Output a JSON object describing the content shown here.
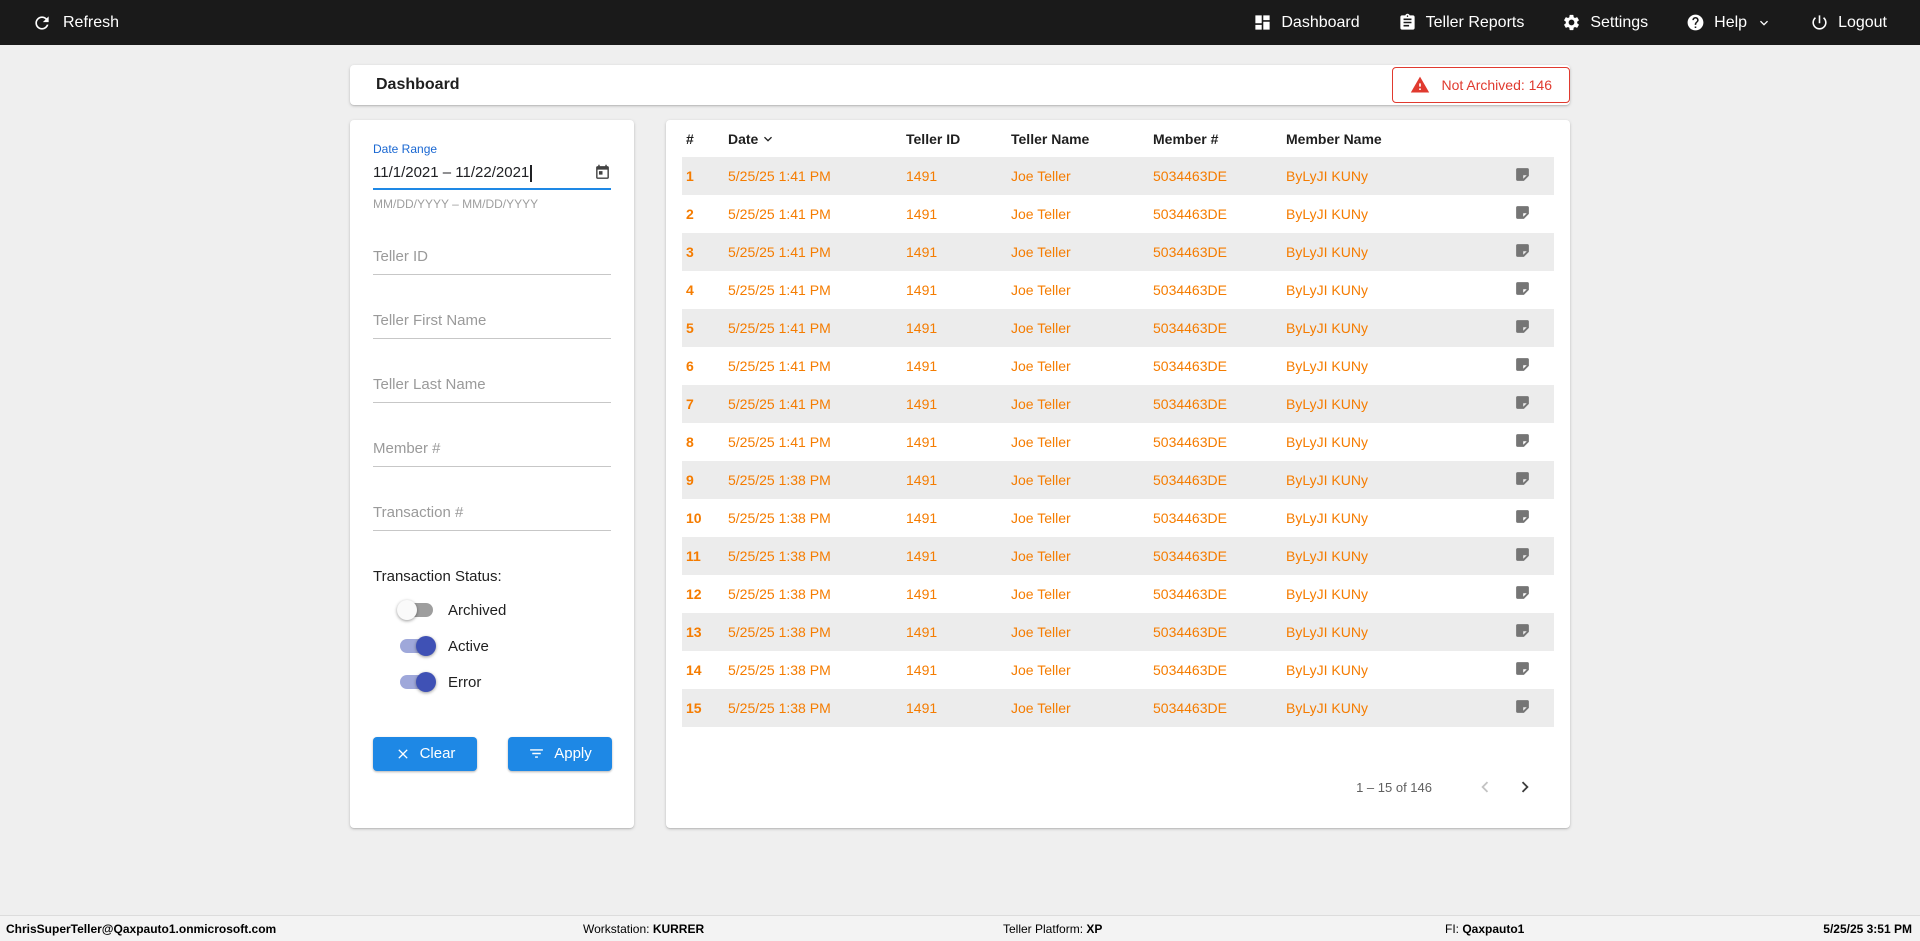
{
  "colors": {
    "accent-orange": "#F57C00",
    "primary-blue": "#1E88E5",
    "alert-red": "#E03A2F",
    "topbar-bg": "#1A1A1A"
  },
  "topbar": {
    "refresh_label": "Refresh",
    "dashboard_label": "Dashboard",
    "teller_reports_label": "Teller Reports",
    "settings_label": "Settings",
    "help_label": "Help",
    "logout_label": "Logout"
  },
  "header": {
    "title": "Dashboard",
    "not_archived_badge": "Not Archived: 146"
  },
  "filters": {
    "date_range_label": "Date Range",
    "date_range_value": "11/1/2021 – 11/22/2021",
    "date_range_hint": "MM/DD/YYYY – MM/DD/YYYY",
    "teller_id_placeholder": "Teller ID",
    "teller_first_name_placeholder": "Teller First Name",
    "teller_last_name_placeholder": "Teller Last Name",
    "member_number_placeholder": "Member #",
    "transaction_number_placeholder": "Transaction #",
    "transaction_status_label": "Transaction Status:",
    "toggles": [
      {
        "label": "Archived",
        "on": false
      },
      {
        "label": "Active",
        "on": true
      },
      {
        "label": "Error",
        "on": true
      }
    ],
    "clear_button": "Clear",
    "apply_button": "Apply"
  },
  "table": {
    "columns": {
      "num": "#",
      "date": "Date",
      "teller_id": "Teller ID",
      "teller_name": "Teller Name",
      "member_number": "Member #",
      "member_name": "Member Name"
    },
    "rows": [
      {
        "num": "1",
        "date": "5/25/25 1:41 PM",
        "teller_id": "1491",
        "teller_name": "Joe Teller",
        "member_number": "5034463DE",
        "member_name": "ByLyJI KUNy"
      },
      {
        "num": "2",
        "date": "5/25/25 1:41 PM",
        "teller_id": "1491",
        "teller_name": "Joe Teller",
        "member_number": "5034463DE",
        "member_name": "ByLyJI KUNy"
      },
      {
        "num": "3",
        "date": "5/25/25 1:41 PM",
        "teller_id": "1491",
        "teller_name": "Joe Teller",
        "member_number": "5034463DE",
        "member_name": "ByLyJI KUNy"
      },
      {
        "num": "4",
        "date": "5/25/25 1:41 PM",
        "teller_id": "1491",
        "teller_name": "Joe Teller",
        "member_number": "5034463DE",
        "member_name": "ByLyJI KUNy"
      },
      {
        "num": "5",
        "date": "5/25/25 1:41 PM",
        "teller_id": "1491",
        "teller_name": "Joe Teller",
        "member_number": "5034463DE",
        "member_name": "ByLyJI KUNy"
      },
      {
        "num": "6",
        "date": "5/25/25 1:41 PM",
        "teller_id": "1491",
        "teller_name": "Joe Teller",
        "member_number": "5034463DE",
        "member_name": "ByLyJI KUNy"
      },
      {
        "num": "7",
        "date": "5/25/25 1:41 PM",
        "teller_id": "1491",
        "teller_name": "Joe Teller",
        "member_number": "5034463DE",
        "member_name": "ByLyJI KUNy"
      },
      {
        "num": "8",
        "date": "5/25/25 1:41 PM",
        "teller_id": "1491",
        "teller_name": "Joe Teller",
        "member_number": "5034463DE",
        "member_name": "ByLyJI KUNy"
      },
      {
        "num": "9",
        "date": "5/25/25 1:38 PM",
        "teller_id": "1491",
        "teller_name": "Joe Teller",
        "member_number": "5034463DE",
        "member_name": "ByLyJI KUNy"
      },
      {
        "num": "10",
        "date": "5/25/25 1:38 PM",
        "teller_id": "1491",
        "teller_name": "Joe Teller",
        "member_number": "5034463DE",
        "member_name": "ByLyJI KUNy"
      },
      {
        "num": "11",
        "date": "5/25/25 1:38 PM",
        "teller_id": "1491",
        "teller_name": "Joe Teller",
        "member_number": "5034463DE",
        "member_name": "ByLyJI KUNy"
      },
      {
        "num": "12",
        "date": "5/25/25 1:38 PM",
        "teller_id": "1491",
        "teller_name": "Joe Teller",
        "member_number": "5034463DE",
        "member_name": "ByLyJI KUNy"
      },
      {
        "num": "13",
        "date": "5/25/25 1:38 PM",
        "teller_id": "1491",
        "teller_name": "Joe Teller",
        "member_number": "5034463DE",
        "member_name": "ByLyJI KUNy"
      },
      {
        "num": "14",
        "date": "5/25/25 1:38 PM",
        "teller_id": "1491",
        "teller_name": "Joe Teller",
        "member_number": "5034463DE",
        "member_name": "ByLyJI KUNy"
      },
      {
        "num": "15",
        "date": "5/25/25 1:38 PM",
        "teller_id": "1491",
        "teller_name": "Joe Teller",
        "member_number": "5034463DE",
        "member_name": "ByLyJI KUNy"
      }
    ],
    "pagination_label": "1 – 15 of 146"
  },
  "statusbar": {
    "user": "ChrisSuperTeller@Qaxpauto1.onmicrosoft.com",
    "workstation_label": "Workstation:",
    "workstation_value": "KURRER",
    "teller_platform_label": "Teller Platform:",
    "teller_platform_value": "XP",
    "fi_label": "FI:",
    "fi_value": "Qaxpauto1",
    "datetime": "5/25/25 3:51 PM"
  }
}
